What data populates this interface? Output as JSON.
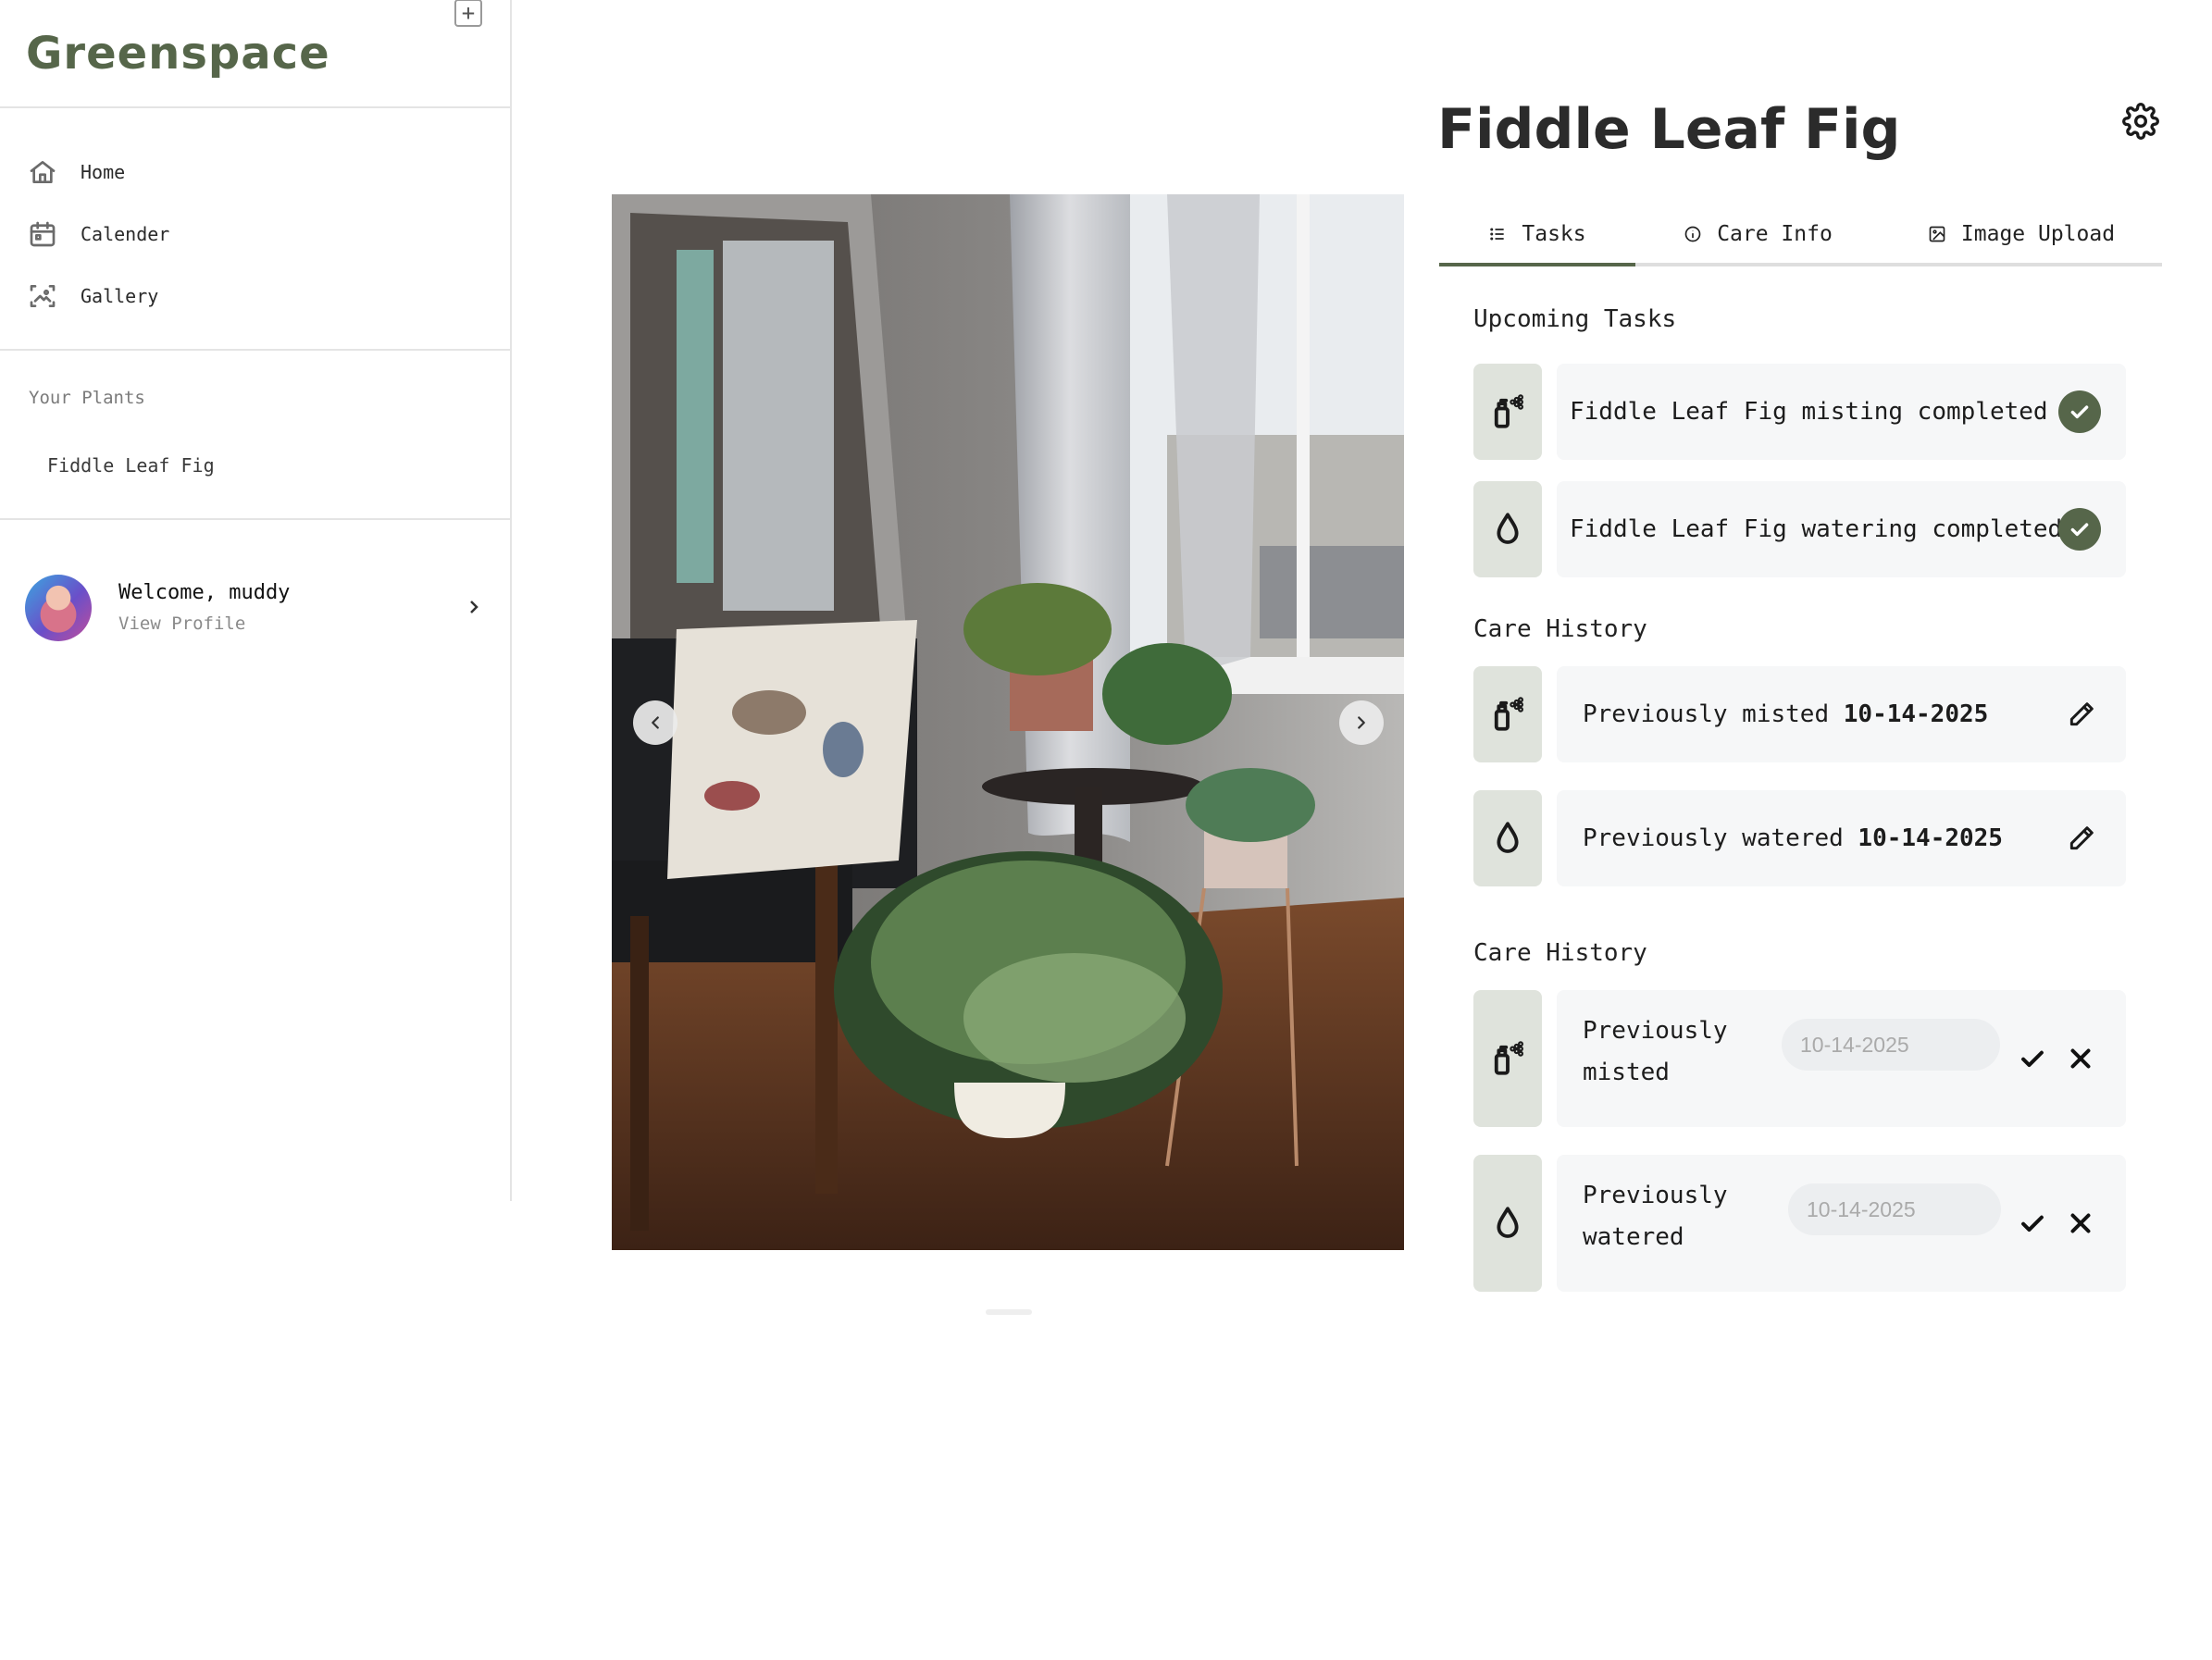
{
  "app": {
    "brand": "Greenspace"
  },
  "sidebar": {
    "nav": [
      {
        "label": "Home",
        "icon": "home-icon"
      },
      {
        "label": "Calender",
        "icon": "calendar-icon"
      },
      {
        "label": "Gallery",
        "icon": "gallery-icon"
      }
    ],
    "plants_header": "Your Plants",
    "add_label": "+",
    "plants": [
      {
        "label": "Fiddle Leaf Fig"
      }
    ],
    "profile": {
      "welcome": "Welcome, muddy",
      "view_profile": "View Profile"
    }
  },
  "plant": {
    "title": "Fiddle Leaf Fig",
    "tabs": [
      {
        "label": "Tasks",
        "icon": "list-icon",
        "active": true
      },
      {
        "label": "Care Info",
        "icon": "info-icon",
        "active": false
      },
      {
        "label": "Image Upload",
        "icon": "image-icon",
        "active": false
      }
    ],
    "upcoming": {
      "heading": "Upcoming Tasks",
      "items": [
        {
          "text": "Fiddle Leaf Fig misting completed",
          "icon": "spray-bottle-icon"
        },
        {
          "text": "Fiddle Leaf Fig watering completed",
          "icon": "water-drop-icon"
        }
      ]
    },
    "history": {
      "heading": "Care History",
      "items": [
        {
          "prefix": "Previously misted ",
          "date": "10-14-2025",
          "icon": "spray-bottle-icon"
        },
        {
          "prefix": "Previously watered ",
          "date": "10-14-2025",
          "icon": "water-drop-icon"
        }
      ]
    },
    "history_edit": {
      "heading": "Care History",
      "items": [
        {
          "label": "Previously misted",
          "placeholder": "10-14-2025",
          "icon": "spray-bottle-icon"
        },
        {
          "label": "Previously watered",
          "placeholder": "10-14-2025",
          "icon": "water-drop-icon"
        }
      ]
    }
  },
  "colors": {
    "brand": "#56664a",
    "icon_bg": "#dfe3dc",
    "card_bg": "#f6f7f8"
  }
}
